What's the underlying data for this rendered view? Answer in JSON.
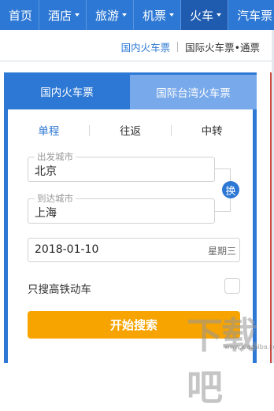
{
  "topnav": {
    "items": [
      {
        "label": "首页",
        "dropdown": false,
        "active": false
      },
      {
        "label": "酒店",
        "dropdown": true,
        "active": false
      },
      {
        "label": "旅游",
        "dropdown": true,
        "active": false
      },
      {
        "label": "机票",
        "dropdown": true,
        "active": false
      },
      {
        "label": "火车",
        "dropdown": true,
        "active": true
      },
      {
        "label": "汽车票",
        "dropdown": true,
        "active": false
      }
    ]
  },
  "subnav": {
    "domestic_link": "国内火车票",
    "intl_link": "国际火车票•通票"
  },
  "booking": {
    "tabs": [
      {
        "label": "国内火车票",
        "selected": true
      },
      {
        "label": "国际台湾火车票",
        "selected": false
      }
    ],
    "trip_types": [
      {
        "label": "单程",
        "selected": true
      },
      {
        "label": "往返",
        "selected": false
      },
      {
        "label": "中转",
        "selected": false
      }
    ],
    "from": {
      "label": "出发城市",
      "value": "北京"
    },
    "to": {
      "label": "到达城市",
      "value": "上海"
    },
    "swap_label": "换",
    "date": {
      "value": "2018-01-10",
      "weekday": "星期三"
    },
    "high_speed_only": {
      "label": "只搜高铁动车",
      "checked": false
    },
    "search_button": "开始搜索"
  },
  "watermark": {
    "text": "下载吧",
    "url_text": "www.xiazaiba.com"
  },
  "colors": {
    "primary": "#2d78d4",
    "active_nav": "#1f5cb0",
    "secondary_tab": "#78a9ea",
    "search": "#f7a400"
  }
}
